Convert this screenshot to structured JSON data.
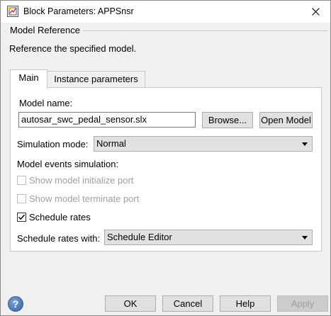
{
  "window": {
    "title": "Block Parameters: APPSnsr",
    "icon": "simulink-block-icon"
  },
  "header": {
    "group_title": "Model Reference",
    "description": "Reference the specified model."
  },
  "tabs": [
    {
      "label": "Main",
      "active": true
    },
    {
      "label": "Instance parameters",
      "active": false
    }
  ],
  "main": {
    "model_name_label": "Model name:",
    "model_name_value": "autosar_swc_pedal_sensor.slx",
    "browse_label": "Browse...",
    "open_model_label": "Open Model",
    "simulation_mode_label": "Simulation mode:",
    "simulation_mode_value": "Normal",
    "model_events_label": "Model events simulation:",
    "show_init_port_label": "Show model initialize port",
    "show_init_port_checked": false,
    "show_term_port_label": "Show model terminate port",
    "show_term_port_checked": false,
    "schedule_rates_label": "Schedule rates",
    "schedule_rates_checked": true,
    "schedule_rates_with_label": "Schedule rates with:",
    "schedule_rates_with_value": "Schedule Editor"
  },
  "footer": {
    "help_icon_glyph": "?",
    "ok_label": "OK",
    "cancel_label": "Cancel",
    "help_label": "Help",
    "apply_label": "Apply"
  }
}
